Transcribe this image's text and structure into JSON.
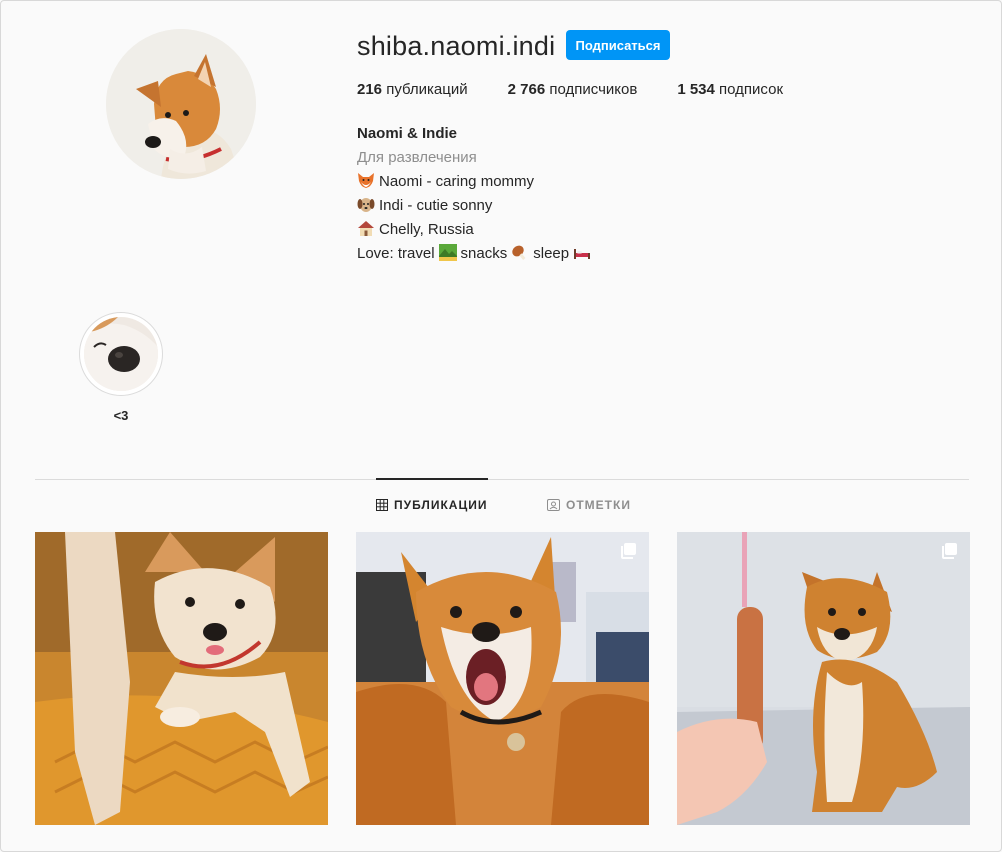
{
  "profile": {
    "username": "shiba.naomi.indi",
    "follow_label": "Подписаться",
    "stats": [
      {
        "count": "216",
        "label": "публикаций"
      },
      {
        "count": "2 766",
        "label": "подписчиков"
      },
      {
        "count": "1 534",
        "label": "подписок"
      }
    ],
    "bio": {
      "name": "Naomi & Indie",
      "category": "Для развлечения",
      "line1": "Naomi - caring mommy",
      "line2": "Indi - cutie sonny",
      "line3": "Chelly, Russia",
      "line4_a": "Love: travel",
      "line4_b": "snacks",
      "line4_c": "sleep"
    }
  },
  "highlights": [
    {
      "label": "<3"
    }
  ],
  "tabs": [
    {
      "label": "ПУБЛИКАЦИИ",
      "active": true,
      "icon": "grid-icon"
    },
    {
      "label": "ОТМЕТКИ",
      "active": false,
      "icon": "tagged-icon"
    }
  ],
  "posts": [
    {
      "description": "shiba on orange blanket",
      "multi": false
    },
    {
      "description": "yawning shiba",
      "multi": true
    },
    {
      "description": "shiba with sausage",
      "multi": true
    }
  ],
  "colors": {
    "accent": "#0095f6",
    "text": "#262626",
    "muted": "#8e8e8e",
    "border": "#dbdbdb"
  }
}
